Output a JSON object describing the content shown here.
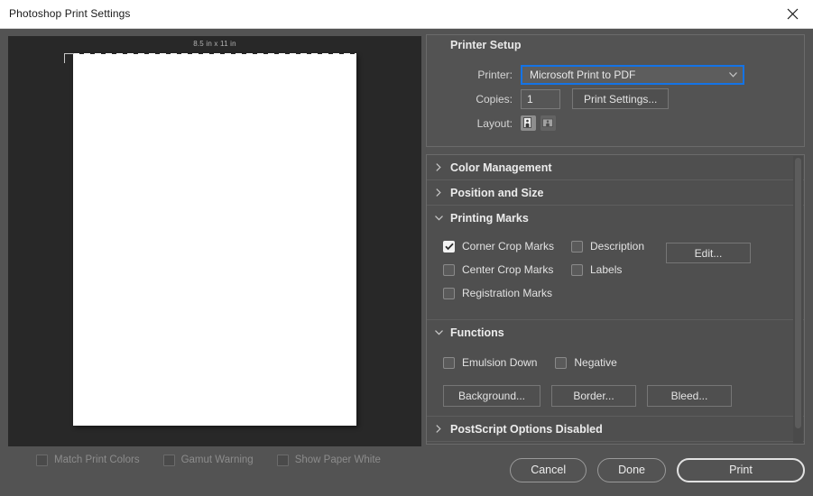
{
  "window": {
    "title": "Photoshop Print Settings",
    "close_icon": "close-icon"
  },
  "preview": {
    "paper_size_label": "8.5 in x 11 in",
    "options": [
      {
        "label": "Match Print Colors",
        "checked": false,
        "enabled": false
      },
      {
        "label": "Gamut Warning",
        "checked": false,
        "enabled": false
      },
      {
        "label": "Show Paper White",
        "checked": false,
        "enabled": false
      }
    ]
  },
  "printer_setup": {
    "title": "Printer Setup",
    "printer_label": "Printer:",
    "printer_value": "Microsoft Print to PDF",
    "copies_label": "Copies:",
    "copies_value": "1",
    "print_settings_button": "Print Settings...",
    "layout_label": "Layout:",
    "layout_portrait_icon": "layout-portrait-icon",
    "layout_landscape_icon": "layout-landscape-icon",
    "layout_selected": "portrait",
    "focus_color": "#1473e6"
  },
  "sections": {
    "color_management": {
      "title": "Color Management",
      "expanded": false
    },
    "position_and_size": {
      "title": "Position and Size",
      "expanded": false
    },
    "printing_marks": {
      "title": "Printing Marks",
      "expanded": true,
      "checkboxes": [
        {
          "label": "Corner Crop Marks",
          "checked": true
        },
        {
          "label": "Center Crop Marks",
          "checked": false
        },
        {
          "label": "Registration Marks",
          "checked": false
        },
        {
          "label": "Description",
          "checked": false
        },
        {
          "label": "Labels",
          "checked": false
        }
      ],
      "edit_button": "Edit..."
    },
    "functions": {
      "title": "Functions",
      "expanded": true,
      "checkboxes": [
        {
          "label": "Emulsion Down",
          "checked": false
        },
        {
          "label": "Negative",
          "checked": false
        }
      ],
      "buttons": [
        "Background...",
        "Border...",
        "Bleed..."
      ]
    },
    "postscript": {
      "title": "PostScript Options Disabled",
      "expanded": false
    }
  },
  "footer": {
    "cancel": "Cancel",
    "done": "Done",
    "print": "Print"
  }
}
